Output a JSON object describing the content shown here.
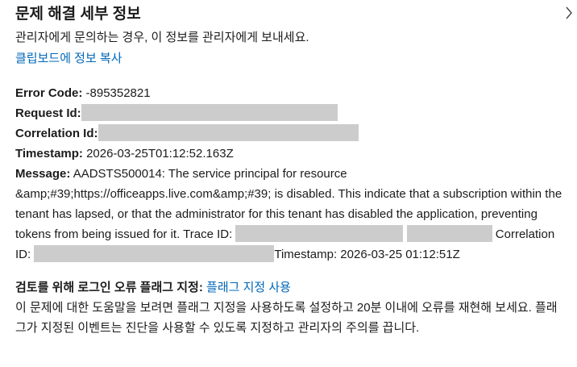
{
  "panel": {
    "title": "문제 해결 세부 정보",
    "subtitle": "관리자에게 문의하는 경우, 이 정보를 관리자에게 보내세요.",
    "copy_link": "클립보드에 정보 복사"
  },
  "chevron_icon": "chevron-right-icon",
  "details": {
    "error_code_label": "Error Code:",
    "error_code_value": " -895352821",
    "request_id_label": "Request Id:",
    "correlation_id_label": "Correlation Id:",
    "timestamp_label": "Timestamp:",
    "timestamp_value": " 2026-03-25T01:12:52.163Z",
    "message_label": "Message:",
    "message_text": " AADSTS500014: The service principal for resource &amp;#39;https://officeapps.live.com&amp;#39; is disabled. This indicate that a subscription within the tenant has lapsed, or that the administrator for this tenant has disabled the application, preventing tokens from being issued for it. Trace ID: ",
    "message_corr_label": " Correlation ID: ",
    "message_timestamp": "Timestamp: 2026-03-25 01:12:51Z"
  },
  "flagging": {
    "label": "검토를 위해 로그인 오류 플래그 지정:",
    "link": "플래그 지정 사용",
    "description": "이 문제에 대한 도움말을 보려면 플래그 지정을 사용하도록 설정하고 20분 이내에 오류를 재현해 보세요. 플래그가 지정된 이벤트는 진단을 사용할 수 있도록 지정하고 관리자의 주의를 끕니다."
  },
  "colors": {
    "link": "#0067b8",
    "redaction": "#cccccc",
    "text": "#1b1b1b"
  }
}
